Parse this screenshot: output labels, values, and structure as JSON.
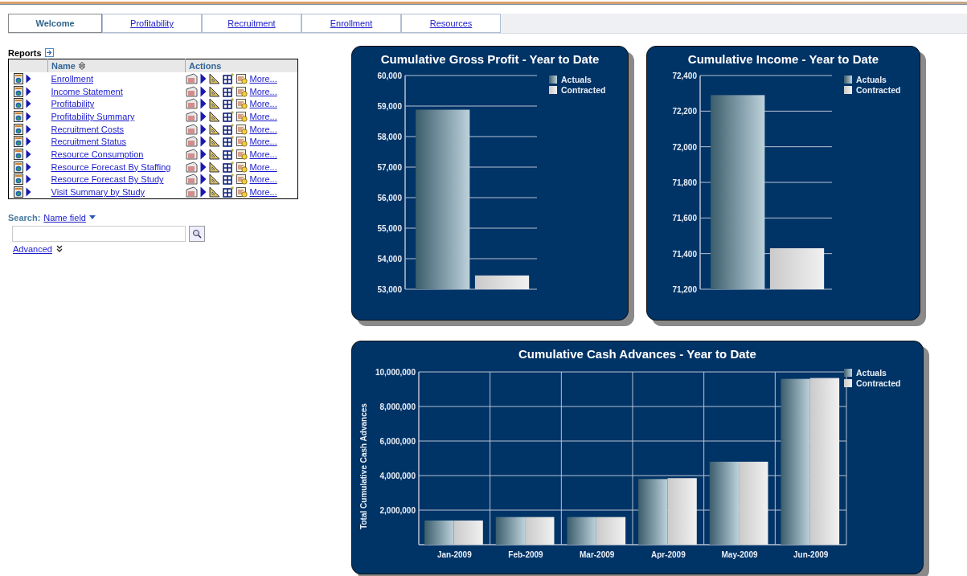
{
  "tabs": [
    {
      "label": "Welcome",
      "selected": true
    },
    {
      "label": "Profitability",
      "selected": false
    },
    {
      "label": "Recruitment",
      "selected": false
    },
    {
      "label": "Enrollment",
      "selected": false
    },
    {
      "label": "Resources",
      "selected": false
    }
  ],
  "reports": {
    "title": "Reports",
    "columns": [
      "Name",
      "Actions"
    ],
    "rows": [
      {
        "name": "Enrollment",
        "more": "More..."
      },
      {
        "name": "Income Statement",
        "more": "More..."
      },
      {
        "name": "Profitability",
        "more": "More..."
      },
      {
        "name": "Profitability Summary",
        "more": "More..."
      },
      {
        "name": "Recruitment Costs",
        "more": "More..."
      },
      {
        "name": "Recruitment Status",
        "more": "More..."
      },
      {
        "name": "Resource Consumption",
        "more": "More..."
      },
      {
        "name": "Resource Forecast By Staffing",
        "more": "More..."
      },
      {
        "name": "Resource Forecast By Study",
        "more": "More..."
      },
      {
        "name": "Visit Summary by Study",
        "more": "More..."
      }
    ]
  },
  "search": {
    "label": "Search:",
    "field": "Name field",
    "advanced": "Advanced"
  },
  "charts": [
    {
      "chart_data": {
        "type": "bar",
        "title": "Cumulative Gross Profit - Year to Date",
        "categories": [
          null
        ],
        "grid": "y",
        "legend": "right",
        "ylim": [
          53000,
          60000
        ],
        "yticks": [
          {
            "value": 53000,
            "label": "53,000"
          },
          {
            "value": 54000,
            "label": "54,000"
          },
          {
            "value": 55000,
            "label": "55,000"
          },
          {
            "value": 56000,
            "label": "56,000"
          },
          {
            "value": 57000,
            "label": "57,000"
          },
          {
            "value": 58000,
            "label": "58,000"
          },
          {
            "value": 59000,
            "label": "59,000"
          },
          {
            "value": 60000,
            "label": "60,000"
          }
        ],
        "series": [
          {
            "name": "Actuals",
            "color": "#5a8fa6",
            "values": [
              58880
            ]
          },
          {
            "name": "Contracted",
            "color": "#dcdcdc",
            "values": [
              53450
            ]
          }
        ]
      }
    },
    {
      "chart_data": {
        "type": "bar",
        "title": "Cumulative Income - Year to Date",
        "categories": [
          null
        ],
        "grid": "y",
        "legend": "right",
        "ylim": [
          71200,
          72400
        ],
        "yticks": [
          {
            "value": 71200,
            "label": "71,200"
          },
          {
            "value": 71400,
            "label": "71,400"
          },
          {
            "value": 71600,
            "label": "71,600"
          },
          {
            "value": 71800,
            "label": "71,800"
          },
          {
            "value": 72000,
            "label": "72,000"
          },
          {
            "value": 72200,
            "label": "72,200"
          },
          {
            "value": 72400,
            "label": "72,400"
          }
        ],
        "series": [
          {
            "name": "Actuals",
            "color": "#5a8fa6",
            "values": [
              72290
            ]
          },
          {
            "name": "Contracted",
            "color": "#dcdcdc",
            "values": [
              71430
            ]
          }
        ]
      }
    },
    {
      "chart_data": {
        "type": "bar",
        "title": "Cumulative Cash Advances - Year to Date",
        "ylabel": "Total Cumulative Cash Advances",
        "categories": [
          "Jan-2009",
          "Feb-2009",
          "Mar-2009",
          "Apr-2009",
          "May-2009",
          "Jun-2009"
        ],
        "grid": "both",
        "legend": "right",
        "ylim": [
          0,
          10000000
        ],
        "yticks": [
          {
            "value": 2000000,
            "label": "2,000,000"
          },
          {
            "value": 4000000,
            "label": "4,000,000"
          },
          {
            "value": 6000000,
            "label": "6,000,000"
          },
          {
            "value": 8000000,
            "label": "8,000,000"
          },
          {
            "value": 10000000,
            "label": "10,000,000"
          }
        ],
        "series": [
          {
            "name": "Actuals",
            "color": "#5a8fa6",
            "values": [
              1400000,
              1600000,
              1600000,
              3800000,
              4800000,
              9600000
            ]
          },
          {
            "name": "Contracted",
            "color": "#dcdcdc",
            "values": [
              1400000,
              1600000,
              1600000,
              3850000,
              4800000,
              9650000
            ]
          }
        ]
      }
    }
  ]
}
